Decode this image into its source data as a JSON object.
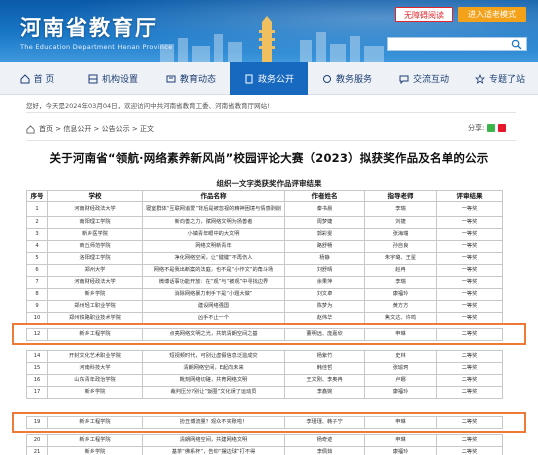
{
  "header": {
    "site_title": "河南省教育厅",
    "site_subtitle": "The Education Department Henan Province",
    "accessible_button": "无障碍阅读",
    "elderly_button": "进入适老模式",
    "search_placeholder": ""
  },
  "nav": {
    "items": [
      {
        "label": "首 页",
        "icon": "home-icon"
      },
      {
        "label": "机构设置",
        "icon": "org-icon"
      },
      {
        "label": "教育动态",
        "icon": "news-icon"
      },
      {
        "label": "政务公开",
        "icon": "doc-icon"
      },
      {
        "label": "教务服务",
        "icon": "service-icon"
      },
      {
        "label": "交流互动",
        "icon": "chat-icon"
      },
      {
        "label": "专题了站",
        "icon": "topic-icon"
      }
    ],
    "active_index": 3
  },
  "welcome": "您好，今天是2024年03月04日，欢迎访问中共河南省教育工委、河南省教育厅网站!",
  "breadcrumb": {
    "text": "首页 > 信息公开 > 公告公示 > 正文",
    "share_label": "分享:"
  },
  "article": {
    "title": "关于河南省“领航·网络素养新风尚”校园评论大赛（2023）拟获奖作品及名单的公示"
  },
  "table": {
    "caption": "组织一文字类获奖作品评审结果",
    "headers": [
      "序号",
      "学校",
      "作品名称",
      "作者姓名",
      "指导老师",
      "评审结果"
    ],
    "rows_top": [
      {
        "no": "1",
        "school": "河南财经政法大学",
        "work": "寝室群体“互联网追爱”背后是被忽视的精神困境与情感剥削",
        "author": "秦书晨",
        "teacher": "李瑞",
        "result": "一等奖"
      },
      {
        "no": "2",
        "school": "南阳理工学院",
        "work": "新向善之力，赋网络文明为扬善者",
        "author": "周梦婕",
        "teacher": "刘捷",
        "result": "一等奖"
      },
      {
        "no": "3",
        "school": "新乡医学院",
        "work": "小镇青年眼中的大文明",
        "author": "郭彩雯",
        "teacher": "张海瑞",
        "result": "一等奖"
      },
      {
        "no": "4",
        "school": "商丘师范学院",
        "work": "网络文明新青年",
        "author": "路舒畅",
        "teacher": "孙自良",
        "result": "一等奖"
      },
      {
        "no": "5",
        "school": "洛阳理工学院",
        "work": "净化网络空间，让“键键”不再伤人",
        "author": "杨静",
        "teacher": "朱宇璐、王星",
        "result": "一等奖"
      },
      {
        "no": "6",
        "school": "郑州大学",
        "work": "网络不是我出断案的法庭，也不是“小作文”的角斗场",
        "author": "刘舒晴",
        "teacher": "赵冉",
        "result": "一等奖"
      },
      {
        "no": "7",
        "school": "河南财经政法大学",
        "work": "微博话事功能开放：在“观”与“被观”中寻找边界",
        "author": "余果萍",
        "teacher": "李瑞",
        "result": "一等奖"
      },
      {
        "no": "8",
        "school": "新乡学院",
        "work": "消除网络暴力刺手下是“小题大做”",
        "author": "刘文卓",
        "teacher": "康福玲",
        "result": "一等奖"
      },
      {
        "no": "9",
        "school": "郑州轻工职业学院",
        "work": "建设网络强国",
        "author": "陈梦为",
        "teacher": "黄方方",
        "result": "一等奖"
      },
      {
        "no": "10",
        "school": "郑州铁路职业技术学院",
        "work": "凶手不止一个",
        "author": "赵伟华",
        "teacher": "焦文达、许鸣",
        "result": "一等奖"
      }
    ],
    "highlight_row_1": {
      "no": "12",
      "school": "新乡工程学院",
      "work": "点亮网络文明之光，共筑清朗空间之基",
      "author": "董明远、庞嘉欣",
      "teacher": "申琳",
      "result": "二等奖"
    },
    "rows_mid": [
      {
        "no": "14",
        "school": "开封文化艺术职业学院",
        "work": "短视频时代，可别让虚假信息泛滥成灾",
        "author": "杨紫竹",
        "teacher": "史林",
        "result": "二等奖"
      },
      {
        "no": "15",
        "school": "河南科技大学",
        "work": "清朗网络空间，E起向未来",
        "author": "韩佳哲",
        "teacher": "张瑜珂",
        "result": "二等奖"
      },
      {
        "no": "16",
        "school": "山东青年政治学院",
        "work": "靴刻网络切磋，共育网络文明",
        "author": "王文刚、李奥冉",
        "teacher": "卢娜",
        "result": "二等奖"
      },
      {
        "no": "17",
        "school": "新乡学院",
        "work": "裁判压分?别让“饭圈”文化误了运动员",
        "author": "李鑫婉",
        "teacher": "康福玲",
        "result": "二等奖"
      }
    ],
    "highlight_row_2": {
      "no": "19",
      "school": "新乡工程学院",
      "work": "扮丑博流量？观众不买账啦！",
      "author": "李瑾瑾、韩子宁",
      "teacher": "申琳",
      "result": "二等奖"
    },
    "rows_bottom": [
      {
        "no": "20",
        "school": "新乡工程学院",
        "work": "清朗网络空间，共建网络文明",
        "author": "杨奇迹",
        "teacher": "申琳",
        "result": "二等奖"
      },
      {
        "no": "21",
        "school": "新乡学院",
        "work": "基茶“佛系杯”，告仰“摆边球”打不得",
        "author": "李佩茹",
        "teacher": "康福玲",
        "result": "二等奖"
      }
    ]
  }
}
